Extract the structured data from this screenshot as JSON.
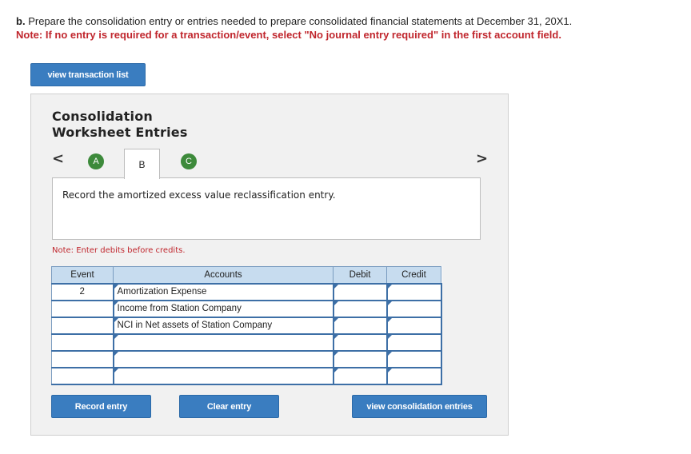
{
  "instructions": {
    "prefix": "b.",
    "text": "Prepare the consolidation entry or entries needed to prepare consolidated financial statements at December 31, 20X1.",
    "note": "Note: If no entry is required for a transaction/event, select \"No journal entry required\" in the first account field."
  },
  "buttons": {
    "view_transaction_list": "view transaction list",
    "record_entry": "Record entry",
    "clear_entry": "Clear entry",
    "view_consolidation_entries": "view consolidation entries"
  },
  "panel": {
    "title_line1": "Consolidation",
    "title_line2": "Worksheet Entries",
    "nav_prev": "<",
    "nav_next": ">",
    "tabs": [
      {
        "label": "A",
        "state": "completed"
      },
      {
        "label": "B",
        "state": "active"
      },
      {
        "label": "C",
        "state": "completed"
      }
    ],
    "description": "Record the amortized excess value reclassification entry.",
    "hint": "Note: Enter debits before credits."
  },
  "table": {
    "headers": {
      "event": "Event",
      "accounts": "Accounts",
      "debit": "Debit",
      "credit": "Credit"
    },
    "rows": [
      {
        "event": "2",
        "account": "Amortization Expense",
        "debit": "",
        "credit": ""
      },
      {
        "event": "",
        "account": "Income from Station Company",
        "debit": "",
        "credit": ""
      },
      {
        "event": "",
        "account": "NCI in Net assets of Station Company",
        "debit": "",
        "credit": ""
      },
      {
        "event": "",
        "account": "",
        "debit": "",
        "credit": ""
      },
      {
        "event": "",
        "account": "",
        "debit": "",
        "credit": ""
      },
      {
        "event": "",
        "account": "",
        "debit": "",
        "credit": ""
      }
    ]
  },
  "colors": {
    "button_blue": "#3a7dc0",
    "tab_green": "#3d8a3b",
    "note_red": "#c0262d",
    "header_blue": "#c7dcef"
  }
}
